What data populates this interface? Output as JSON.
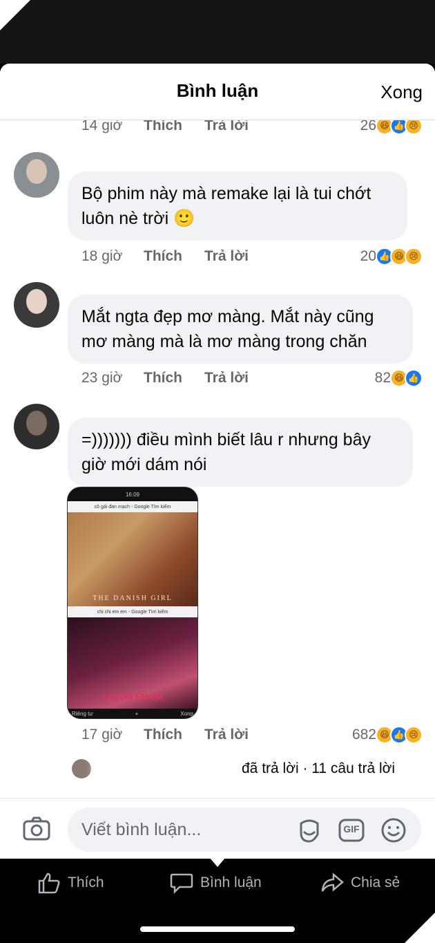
{
  "header": {
    "title": "Bình luận",
    "done": "Xong"
  },
  "comments": [
    {
      "time": "14 giờ",
      "like": "Thích",
      "reply": "Trả lời",
      "reactions": "26"
    },
    {
      "text_l1": "Bộ phim này mà remake lại là tui chớt",
      "text_l2": "luôn nè trời 🙂",
      "time": "18 giờ",
      "like": "Thích",
      "reply": "Trả lời",
      "reactions": "20"
    },
    {
      "text_l1": "Mắt ngta đẹp mơ màng. Mắt này cũng",
      "text_l2": "mơ màng mà là mơ màng trong chăn",
      "time": "23 giờ",
      "like": "Thích",
      "reply": "Trả lời",
      "reactions": "82"
    },
    {
      "text_l1": "=))))))) điều mình biết lâu r nhưng bây",
      "text_l2": "giờ mới dám nói",
      "time": "17 giờ",
      "like": "Thích",
      "reply": "Trả lời",
      "reactions": "682",
      "image": {
        "status_time": "16:09",
        "search1": "cô gái đan mạch - Google Tìm kiếm",
        "poster1": "THE DANISH GIRL",
        "search2": "chị chị em em - Google Tìm kiếm",
        "poster2": "CHỊ CHỊ EM EM",
        "bottom_left": "Riêng tư",
        "bottom_plus": "+",
        "bottom_right": "Xong"
      }
    }
  ],
  "replies_summary": "đã trả lời · 11 câu trả lời",
  "composer": {
    "placeholder": "Viết bình luận...",
    "gif": "GIF"
  },
  "actions": {
    "like": "Thích",
    "comment": "Bình luận",
    "share": "Chia sẻ"
  },
  "colors": {
    "accent": "#1877f2",
    "bubble": "#f0f2f5",
    "meta": "#65676b"
  }
}
